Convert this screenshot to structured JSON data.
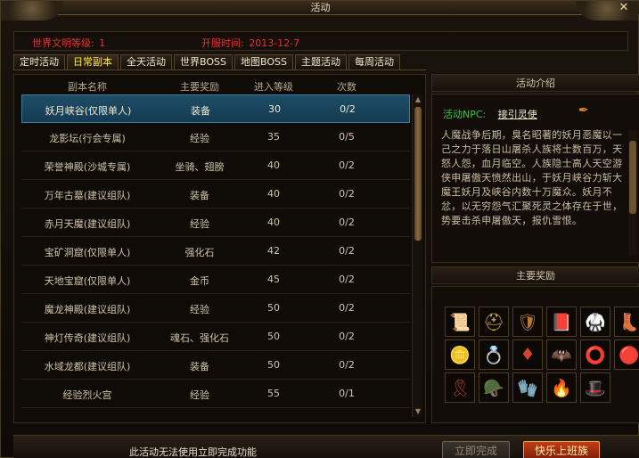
{
  "window": {
    "title": "活动"
  },
  "info": {
    "world_label": "世界文明等级:",
    "world_value": "1",
    "open_label": "开服时间:",
    "open_value": "2013-12-7"
  },
  "tabs": [
    {
      "label": "定时活动",
      "active": false
    },
    {
      "label": "日常副本",
      "active": true
    },
    {
      "label": "全天活动",
      "active": false
    },
    {
      "label": "世界BOSS",
      "active": false
    },
    {
      "label": "地图BOSS",
      "active": false
    },
    {
      "label": "主题活动",
      "active": false
    },
    {
      "label": "每周活动",
      "active": false
    }
  ],
  "table": {
    "headers": [
      "副本名称",
      "主要奖励",
      "进入等级",
      "次数"
    ],
    "rows": [
      {
        "name": "妖月峡谷(仅限单人)",
        "reward": "装备",
        "level": "30",
        "count": "0/2",
        "selected": true
      },
      {
        "name": "龙影坛(行会专属)",
        "reward": "经验",
        "level": "35",
        "count": "0/5"
      },
      {
        "name": "荣誉神殿(沙城专属)",
        "reward": "坐骑、翅膀",
        "level": "40",
        "count": "0/2"
      },
      {
        "name": "万年古墓(建议组队)",
        "reward": "装备",
        "level": "40",
        "count": "0/2"
      },
      {
        "name": "赤月天魔(建议组队)",
        "reward": "经验",
        "level": "40",
        "count": "0/2"
      },
      {
        "name": "宝矿洞窟(仅限单人)",
        "reward": "强化石",
        "level": "42",
        "count": "0/2"
      },
      {
        "name": "天地宝窟(仅限单人)",
        "reward": "金币",
        "level": "45",
        "count": "0/2"
      },
      {
        "name": "魔龙神殿(建议组队)",
        "reward": "经验",
        "level": "50",
        "count": "0/2"
      },
      {
        "name": "神灯传奇(建议组队)",
        "reward": "魂石、强化石",
        "level": "50",
        "count": "0/2"
      },
      {
        "name": "水域龙都(建议组队)",
        "reward": "装备",
        "level": "50",
        "count": "0/2"
      },
      {
        "name": "经验烈火宫",
        "reward": "经验",
        "level": "55",
        "count": "0/1"
      }
    ]
  },
  "intro": {
    "title": "活动介绍",
    "npc_label": "活动NPC:",
    "npc_name": "接引灵使",
    "text": "人魔战争后期，臭名昭著的妖月恶魔以一己之力于落日山屠杀人族将士数百万，天怒人怨，血月临空。人族隐士高人天空游侠申屠傲天愤然出山，于妖月峡谷力斩大魔王妖月及峡谷内数十万魔众。妖月不忿，以无穷怨气汇聚死灵之体存在于世，势要击杀申屠傲天，报仇雪恨。"
  },
  "rewards": {
    "title": "主要奖励",
    "items": [
      {
        "icon": "scroll-icon",
        "glyph": "📜",
        "color": "#d79a2a"
      },
      {
        "icon": "helmet-icon",
        "glyph": "⛑",
        "color": "#c9a24a"
      },
      {
        "icon": "armor-icon",
        "glyph": "🛡",
        "color": "#b57a3a"
      },
      {
        "icon": "book-icon",
        "glyph": "📕",
        "color": "#c24a2a"
      },
      {
        "icon": "bracer-icon",
        "glyph": "🥋",
        "color": "#d4572a"
      },
      {
        "icon": "boots-icon",
        "glyph": "👢",
        "color": "#b8552a"
      },
      {
        "icon": "gold-coin-icon",
        "glyph": "🪙",
        "color": "#e3c04a"
      },
      {
        "icon": "ring-icon",
        "glyph": "💍",
        "color": "#d99a3a"
      },
      {
        "icon": "gem-icon",
        "glyph": "♦",
        "color": "#d4442a"
      },
      {
        "icon": "wings-icon",
        "glyph": "🦇",
        "color": "#d9d2c0"
      },
      {
        "icon": "bracelet-icon",
        "glyph": "⭕",
        "color": "#e0d2a0"
      },
      {
        "icon": "red-orb-icon",
        "glyph": "🔴",
        "color": "#d4322a"
      },
      {
        "icon": "belt-icon",
        "glyph": "🎗",
        "color": "#a03a2a"
      },
      {
        "icon": "pauldron-icon",
        "glyph": "🪖",
        "color": "#c44a2a"
      },
      {
        "icon": "gauntlet-icon",
        "glyph": "🧤",
        "color": "#d44a3a"
      },
      {
        "icon": "fire-orb-icon",
        "glyph": "🔥",
        "color": "#e0652a"
      },
      {
        "icon": "hat-icon",
        "glyph": "🎩",
        "color": "#c2352a"
      }
    ]
  },
  "bottom": {
    "notice": "此活动无法使用立即完成功能",
    "instant_label": "立即完成",
    "go_label": "快乐上班族"
  }
}
